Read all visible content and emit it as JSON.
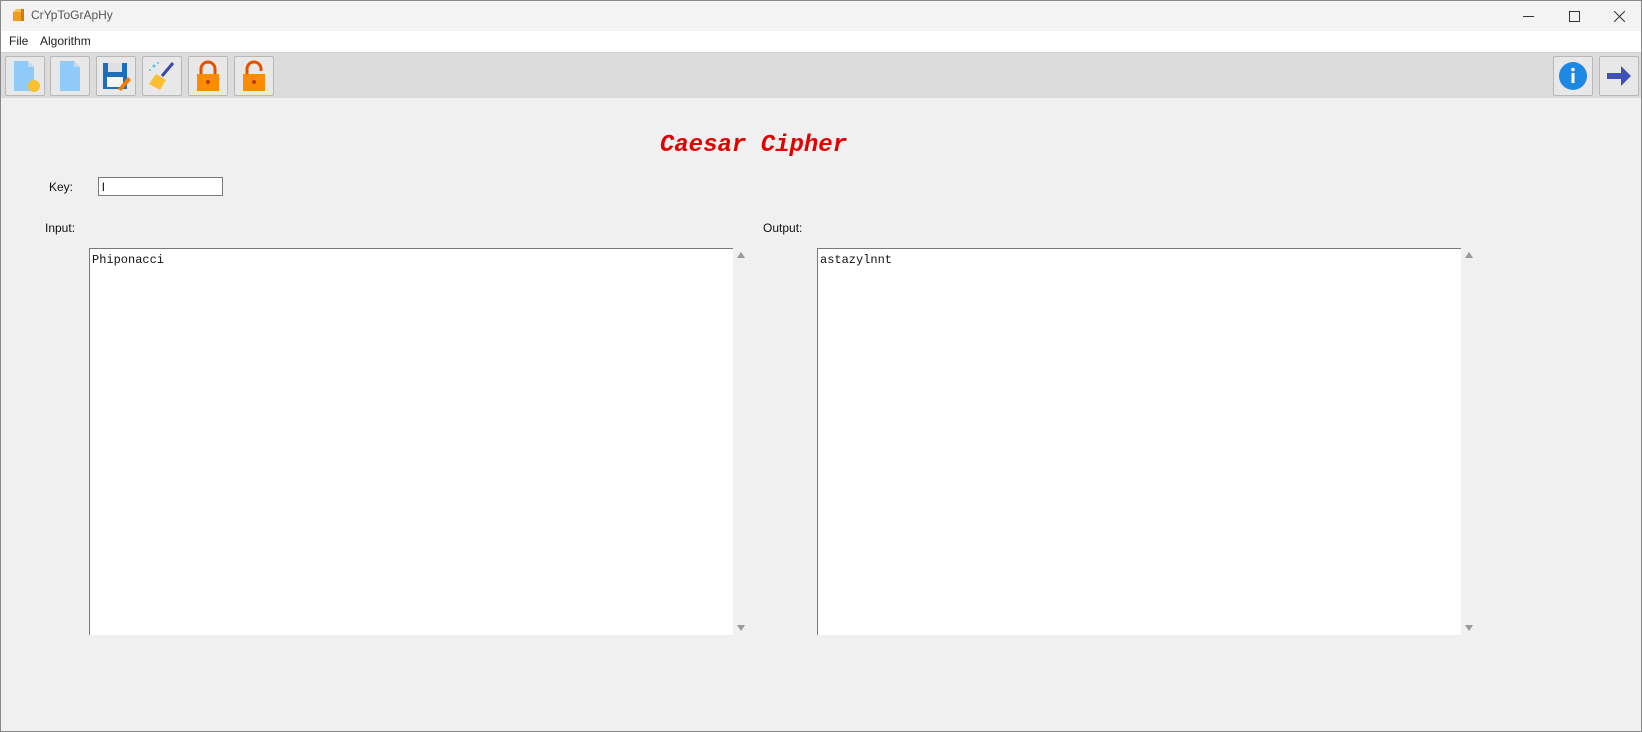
{
  "window": {
    "title": "CrYpToGrApHy"
  },
  "menu": {
    "items": [
      "File",
      "Algorithm"
    ]
  },
  "toolbar": {
    "left_icons": [
      "new-file-icon",
      "open-file-icon",
      "save-icon",
      "clear-icon",
      "encrypt-lock-icon",
      "decrypt-unlock-icon"
    ],
    "right_icons": [
      "info-icon",
      "next-arrow-icon"
    ]
  },
  "main": {
    "heading": "Caesar Cipher",
    "key_label": "Key:",
    "key_value": "l",
    "input_label": "Input:",
    "input_text": "Phiponacci",
    "output_label": "Output:",
    "output_text": "astazylnnt"
  },
  "colors": {
    "heading": "#e10000",
    "toolbar_bg": "#dcdcdc",
    "window_bg": "#f0f0f0"
  }
}
